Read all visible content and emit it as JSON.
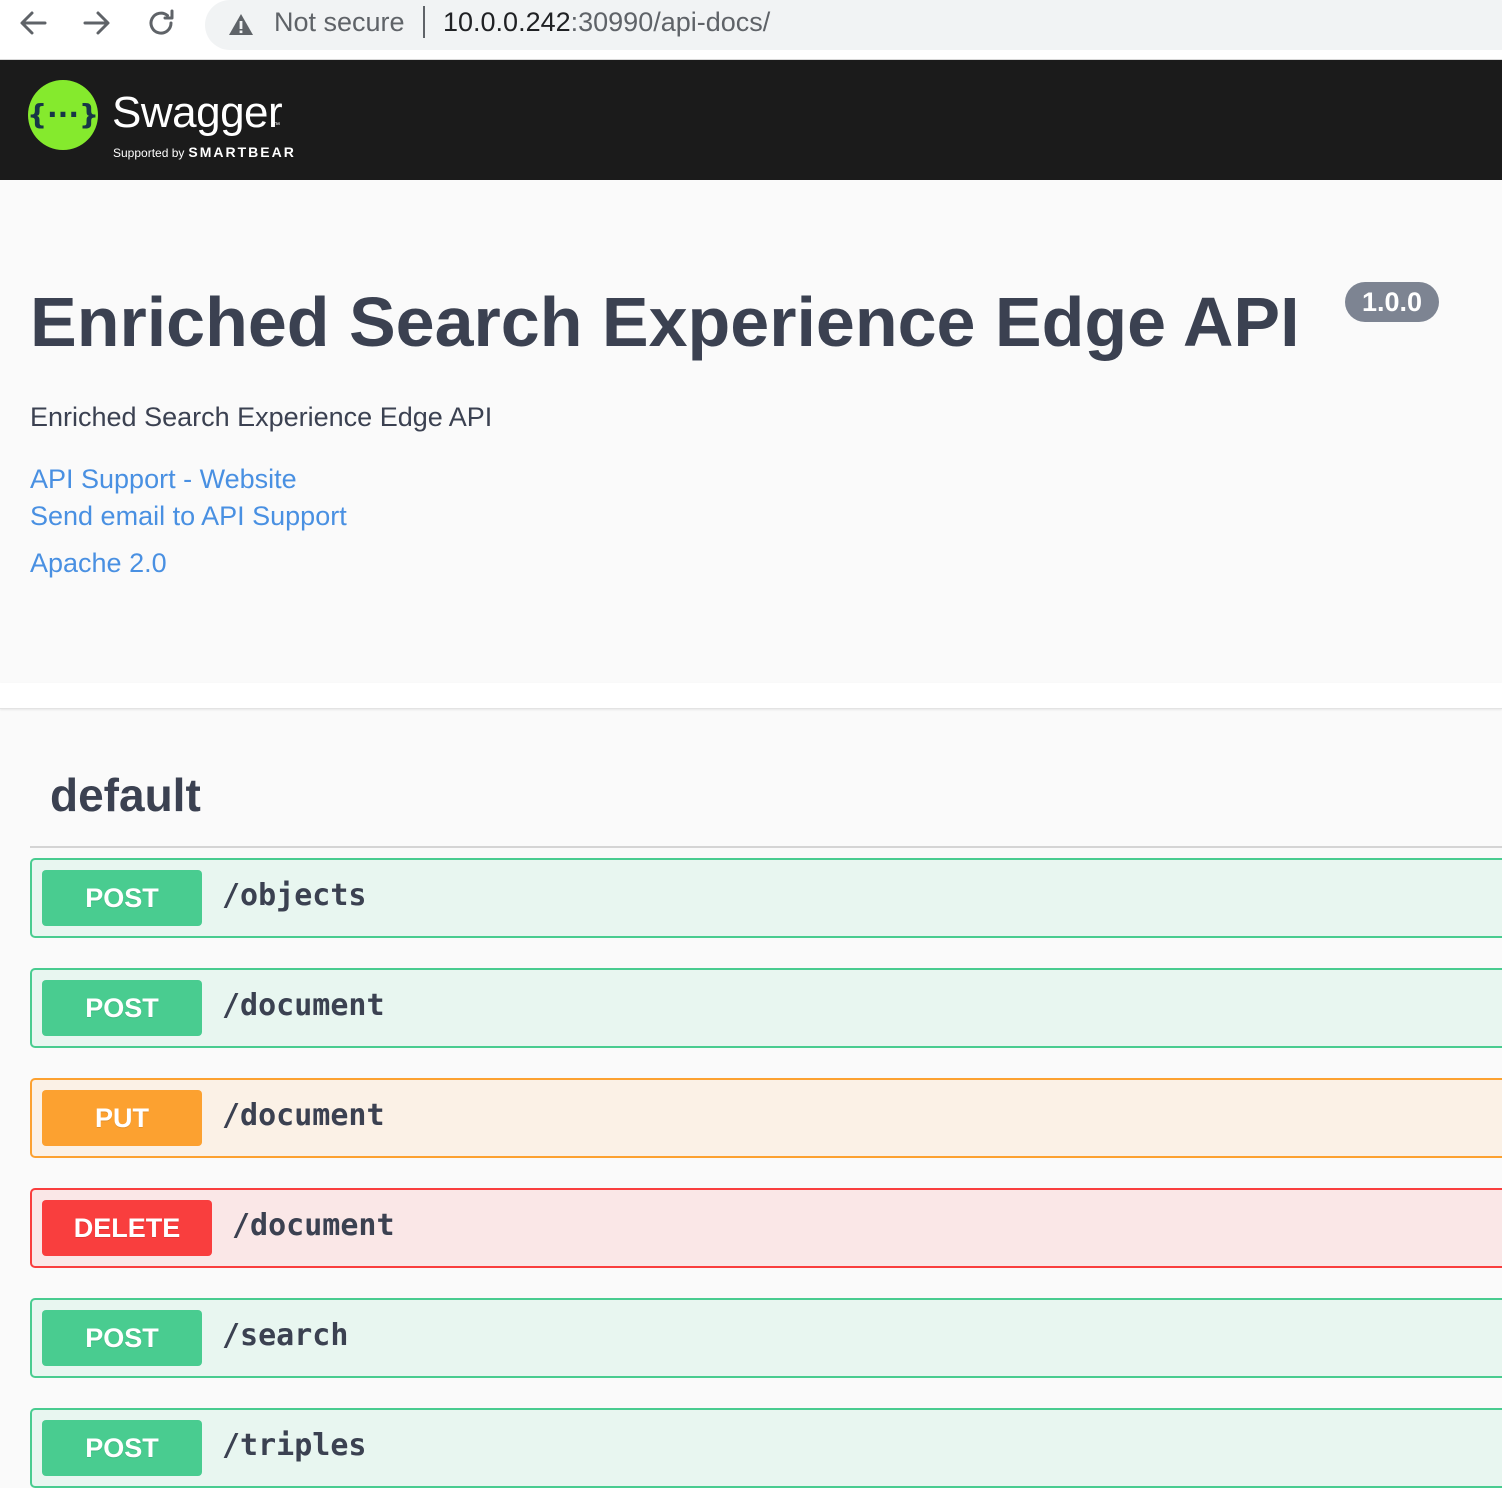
{
  "browser": {
    "security_label": "Not secure",
    "url_host": "10.0.0.242",
    "url_rest": ":30990/api-docs/"
  },
  "topbar": {
    "brand_name": "Swagger",
    "trademark": "™",
    "supported_by": "Supported by",
    "company": "SMARTBEAR"
  },
  "info": {
    "title": "Enriched Search Experience Edge API",
    "version": "1.0.0",
    "description": "Enriched Search Experience Edge API",
    "links": {
      "website": "API Support - Website",
      "email": "Send email to API Support",
      "license": "Apache 2.0"
    }
  },
  "tag": {
    "name": "default"
  },
  "operations": [
    {
      "method": "POST",
      "path": "/objects"
    },
    {
      "method": "POST",
      "path": "/document"
    },
    {
      "method": "PUT",
      "path": "/document"
    },
    {
      "method": "DELETE",
      "path": "/document"
    },
    {
      "method": "POST",
      "path": "/search"
    },
    {
      "method": "POST",
      "path": "/triples"
    }
  ],
  "colors": {
    "post": "#49cc90",
    "put": "#fca130",
    "delete": "#f93e3e",
    "link": "#4990e2",
    "topbar": "#1b1b1b",
    "logo_green": "#85ea2d"
  },
  "icons": [
    "back-arrow-icon",
    "forward-arrow-icon",
    "reload-icon",
    "warning-icon",
    "swagger-logo-icon"
  ]
}
